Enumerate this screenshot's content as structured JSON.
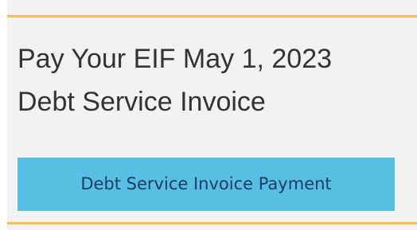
{
  "card": {
    "title_line1": "Pay Your EIF May 1, 2023",
    "title_line2": "Debt Service Invoice",
    "button_label": "Debt Service Invoice Payment"
  },
  "colors": {
    "accent_rule": "#f5c342",
    "button_bg": "#57bfe3",
    "button_text": "#1b3d5f",
    "panel_bg": "#f2f2f2",
    "heading_text": "#333333"
  }
}
